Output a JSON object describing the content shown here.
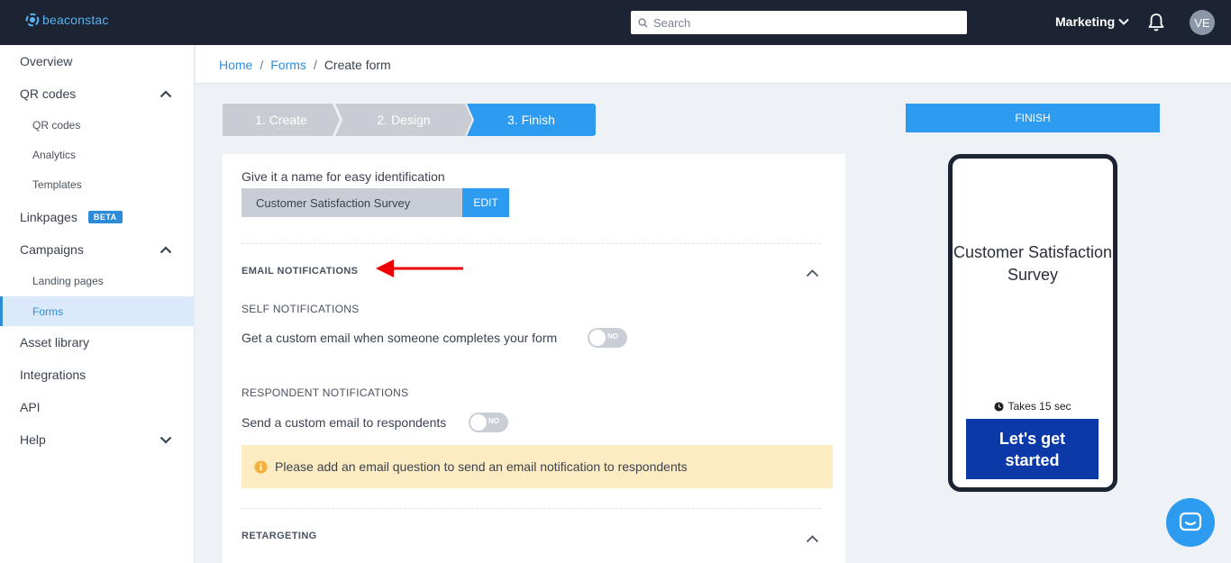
{
  "brand": {
    "logo_text": "beaconstac"
  },
  "topbar": {
    "search_placeholder": "Search",
    "workspace": "Marketing",
    "avatar_initials": "VE"
  },
  "sidebar": {
    "items": [
      {
        "label": "Overview"
      },
      {
        "label": "QR codes"
      },
      {
        "label": "QR codes"
      },
      {
        "label": "Analytics"
      },
      {
        "label": "Templates"
      },
      {
        "label": "Linkpages",
        "badge": "BETA"
      },
      {
        "label": "Campaigns"
      },
      {
        "label": "Landing pages"
      },
      {
        "label": "Forms"
      },
      {
        "label": "Asset library"
      },
      {
        "label": "Integrations"
      },
      {
        "label": "API"
      },
      {
        "label": "Help"
      }
    ]
  },
  "breadcrumb": {
    "home": "Home",
    "sep1": "/",
    "forms": "Forms",
    "sep2": "/",
    "current": "Create form"
  },
  "stepper": {
    "step1": "1. Create",
    "step2": "2. Design",
    "step3": "3. Finish"
  },
  "form": {
    "name_label": "Give it a name for easy identification",
    "name_value": "Customer Satisfaction Survey",
    "edit_label": "EDIT",
    "email_notifications_title": "EMAIL NOTIFICATIONS",
    "self_notifications_title": "SELF NOTIFICATIONS",
    "self_notifications_text": "Get a custom email when someone completes your form",
    "self_toggle": "NO",
    "respondent_notifications_title": "RESPONDENT NOTIFICATIONS",
    "respondent_notifications_text": "Send a custom email to respondents",
    "respondent_toggle": "NO",
    "warning_text": "Please add an email question to send an email notification to respondents",
    "retargeting_title": "RETARGETING"
  },
  "preview": {
    "finish_label": "FINISH",
    "survey_title": "Customer Satisfaction Survey",
    "duration": "Takes 15 sec",
    "cta": "Let's get started"
  },
  "colors": {
    "topbar": "#1c2433",
    "accent": "#2d9bf0",
    "cta": "#0b3aa8",
    "warning_bg": "#fdebc1",
    "annotation_arrow": "#ee0000"
  }
}
